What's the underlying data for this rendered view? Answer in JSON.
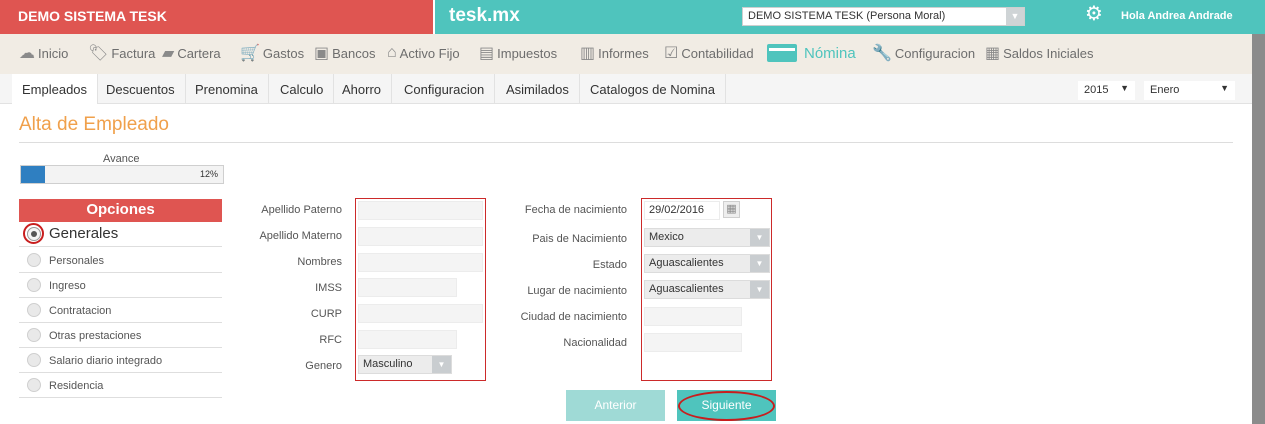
{
  "topbar": {
    "company_title": "DEMO SISTEMA TESK",
    "site_name": "tesk.mx",
    "company_select": "DEMO SISTEMA TESK (Persona Moral)",
    "greeting": "Hola Andrea Andrade",
    "colors": {
      "red": "#df5551",
      "teal": "#4fc4bd"
    }
  },
  "main_nav": [
    {
      "label": "Inicio",
      "icon": "cloud-icon"
    },
    {
      "label": "Factura",
      "icon": "tag-icon"
    },
    {
      "label": "Cartera",
      "icon": "wallet-icon"
    },
    {
      "label": "Gastos",
      "icon": "cart-icon"
    },
    {
      "label": "Bancos",
      "icon": "safe-icon"
    },
    {
      "label": "Activo Fijo",
      "icon": "house-icon"
    },
    {
      "label": "Impuestos",
      "icon": "briefcase-icon"
    },
    {
      "label": "Informes",
      "icon": "document-icon"
    },
    {
      "label": "Contabilidad",
      "icon": "checklist-icon"
    },
    {
      "label": "Nómina",
      "icon": "card-icon"
    },
    {
      "label": "Configuracion",
      "icon": "wrench-icon"
    },
    {
      "label": "Saldos Iniciales",
      "icon": "clipboard-check-icon"
    }
  ],
  "sub_nav": [
    "Empleados",
    "Descuentos",
    "Prenomina",
    "Calculo",
    "Ahorro",
    "Configuracion",
    "Asimilados",
    "Catalogos de Nomina"
  ],
  "period": {
    "year": "2015",
    "month": "Enero"
  },
  "page": {
    "title": "Alta de Empleado"
  },
  "progress": {
    "label": "Avance",
    "value": 0.12,
    "text": "12%"
  },
  "options": {
    "header": "Opciones",
    "items": [
      "Generales",
      "Personales",
      "Ingreso",
      "Contratacion",
      "Otras prestaciones",
      "Salario diario integrado",
      "Residencia"
    ],
    "selected": "Generales"
  },
  "form_left": {
    "apellido_paterno": {
      "label": "Apellido Paterno",
      "value": ""
    },
    "apellido_materno": {
      "label": "Apellido Materno",
      "value": ""
    },
    "nombres": {
      "label": "Nombres",
      "value": ""
    },
    "imss": {
      "label": "IMSS",
      "value": ""
    },
    "curp": {
      "label": "CURP",
      "value": ""
    },
    "rfc": {
      "label": "RFC",
      "value": ""
    },
    "genero": {
      "label": "Genero",
      "value": "Masculino"
    }
  },
  "form_right": {
    "fecha_nacimiento": {
      "label": "Fecha de nacimiento",
      "value": "29/02/2016"
    },
    "pais_nacimiento": {
      "label": "Pais de Nacimiento",
      "value": "Mexico"
    },
    "estado": {
      "label": "Estado",
      "value": "Aguascalientes"
    },
    "lugar_nacimiento": {
      "label": "Lugar de nacimiento",
      "value": "Aguascalientes"
    },
    "ciudad_nacimiento": {
      "label": "Ciudad de nacimiento",
      "value": ""
    },
    "nacionalidad": {
      "label": "Nacionalidad",
      "value": ""
    }
  },
  "buttons": {
    "previous": "Anterior",
    "next": "Siguiente"
  }
}
